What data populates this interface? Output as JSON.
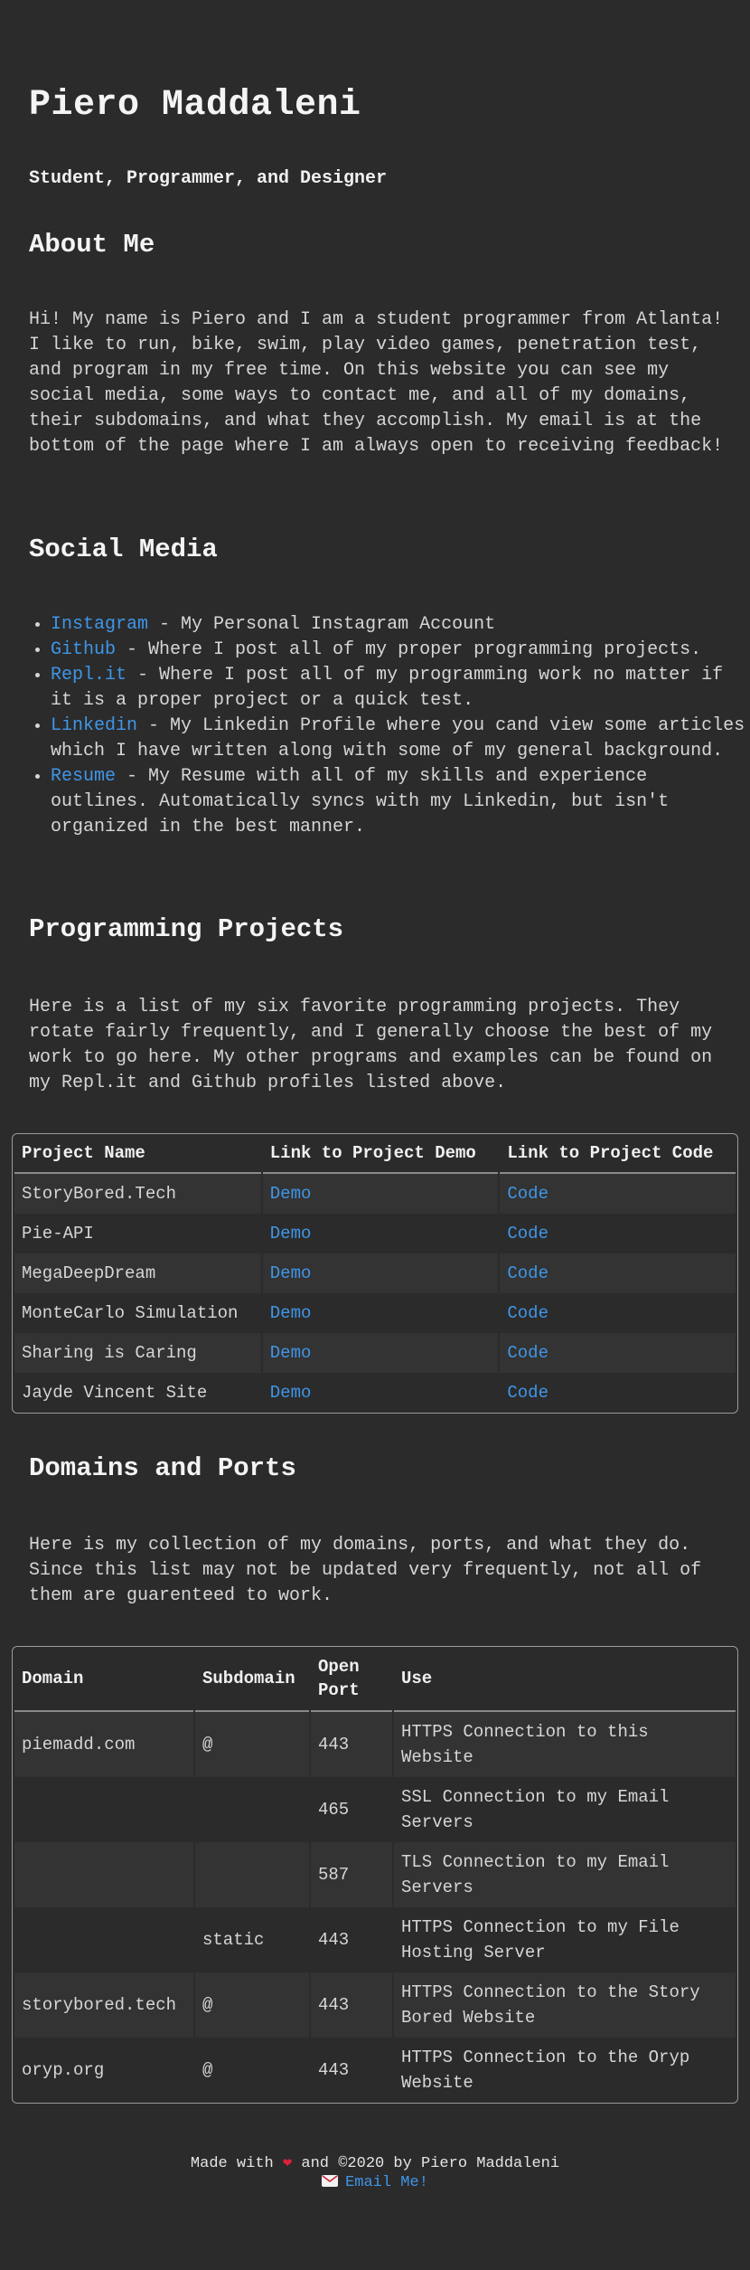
{
  "header": {
    "name": "Piero Maddaleni",
    "tagline": "Student, Programmer, and Designer"
  },
  "about": {
    "heading": "About Me",
    "text": "Hi! My name is Piero and I am a student programmer from Atlanta! I like to run, bike, swim, play video games, penetration test, and program in my free time. On this website you can see my social media, some ways to contact me, and all of my domains, their subdomains, and what they accomplish. My email is at the bottom of the page where I am always open to receiving feedback!"
  },
  "social": {
    "heading": "Social Media",
    "items": [
      {
        "link": "Instagram",
        "desc": " - My Personal Instagram Account"
      },
      {
        "link": "Github",
        "desc": " - Where I post all of my proper programming projects."
      },
      {
        "link": "Repl.it",
        "desc": " - Where I post all of my programming work no matter if it is a proper project or a quick test."
      },
      {
        "link": "Linkedin",
        "desc": " - My Linkedin Profile where you cand view some articles which I have written along with some of my general background."
      },
      {
        "link": "Resume",
        "desc": " - My Resume with all of my skills and experience outlines. Automatically syncs with my Linkedin, but isn't organized in the best manner."
      }
    ]
  },
  "projects": {
    "heading": "Programming Projects",
    "text": "Here is a list of my six favorite programming projects. They rotate fairly frequently, and I generally choose the best of my work to go here. My other programs and examples can be found on my Repl.it and Github profiles listed above.",
    "columns": [
      "Project Name",
      "Link to Project Demo",
      "Link to Project Code"
    ],
    "rows": [
      {
        "name": "StoryBored.Tech",
        "demo": "Demo",
        "code": "Code"
      },
      {
        "name": "Pie-API",
        "demo": "Demo",
        "code": "Code"
      },
      {
        "name": "MegaDeepDream",
        "demo": "Demo",
        "code": "Code"
      },
      {
        "name": "MonteCarlo Simulation",
        "demo": "Demo",
        "code": "Code"
      },
      {
        "name": "Sharing is Caring",
        "demo": "Demo",
        "code": "Code"
      },
      {
        "name": "Jayde Vincent Site",
        "demo": "Demo",
        "code": "Code"
      }
    ]
  },
  "domains": {
    "heading": "Domains and Ports",
    "text": "Here is my collection of my domains, ports, and what they do. Since this list may not be updated very frequently, not all of them are guarenteed to work.",
    "columns": [
      "Domain",
      "Subdomain",
      "Open Port",
      "Use"
    ],
    "rows": [
      {
        "domain": "piemadd.com",
        "sub": "@",
        "port": "443",
        "use": "HTTPS Connection to this Website"
      },
      {
        "domain": "",
        "sub": "",
        "port": "465",
        "use": "SSL Connection to my Email Servers"
      },
      {
        "domain": "",
        "sub": "",
        "port": "587",
        "use": "TLS Connection to my Email Servers"
      },
      {
        "domain": "",
        "sub": "static",
        "port": "443",
        "use": "HTTPS Connection to my File Hosting Server"
      },
      {
        "domain": "storybored.tech",
        "sub": "@",
        "port": "443",
        "use": "HTTPS Connection to the Story Bored Website"
      },
      {
        "domain": "oryp.org",
        "sub": "@",
        "port": "443",
        "use": "HTTPS Connection to the Oryp Website"
      }
    ]
  },
  "footer": {
    "made_with": "Made with",
    "heart": "❤",
    "credit": "and ©2020 by Piero Maddaleni",
    "email_icon": "envelope-icon",
    "email_label": "Email Me!"
  }
}
